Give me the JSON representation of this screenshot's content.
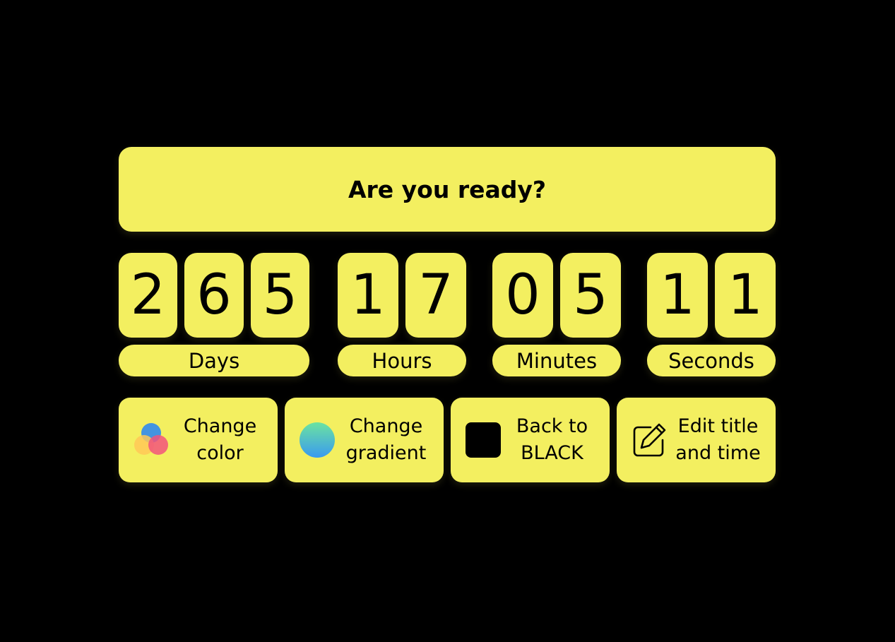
{
  "title": "Are you ready?",
  "countdown": {
    "days": {
      "digits": [
        "2",
        "6",
        "5"
      ],
      "label": "Days"
    },
    "hours": {
      "digits": [
        "1",
        "7"
      ],
      "label": "Hours"
    },
    "minutes": {
      "digits": [
        "0",
        "5"
      ],
      "label": "Minutes"
    },
    "seconds": {
      "digits": [
        "1",
        "1"
      ],
      "label": "Seconds"
    }
  },
  "actions": {
    "change_color": {
      "label": "Change\ncolor",
      "icon": "color-circles-icon"
    },
    "change_gradient": {
      "label": "Change\ngradient",
      "icon": "gradient-circle-icon"
    },
    "back_to_black": {
      "label": "Back to\nBLACK",
      "icon": "black-square-icon"
    },
    "edit": {
      "label": "Edit title\nand time",
      "icon": "edit-icon"
    }
  },
  "colors": {
    "background": "#000000",
    "accent": "#F3EF60",
    "text": "#000000"
  }
}
